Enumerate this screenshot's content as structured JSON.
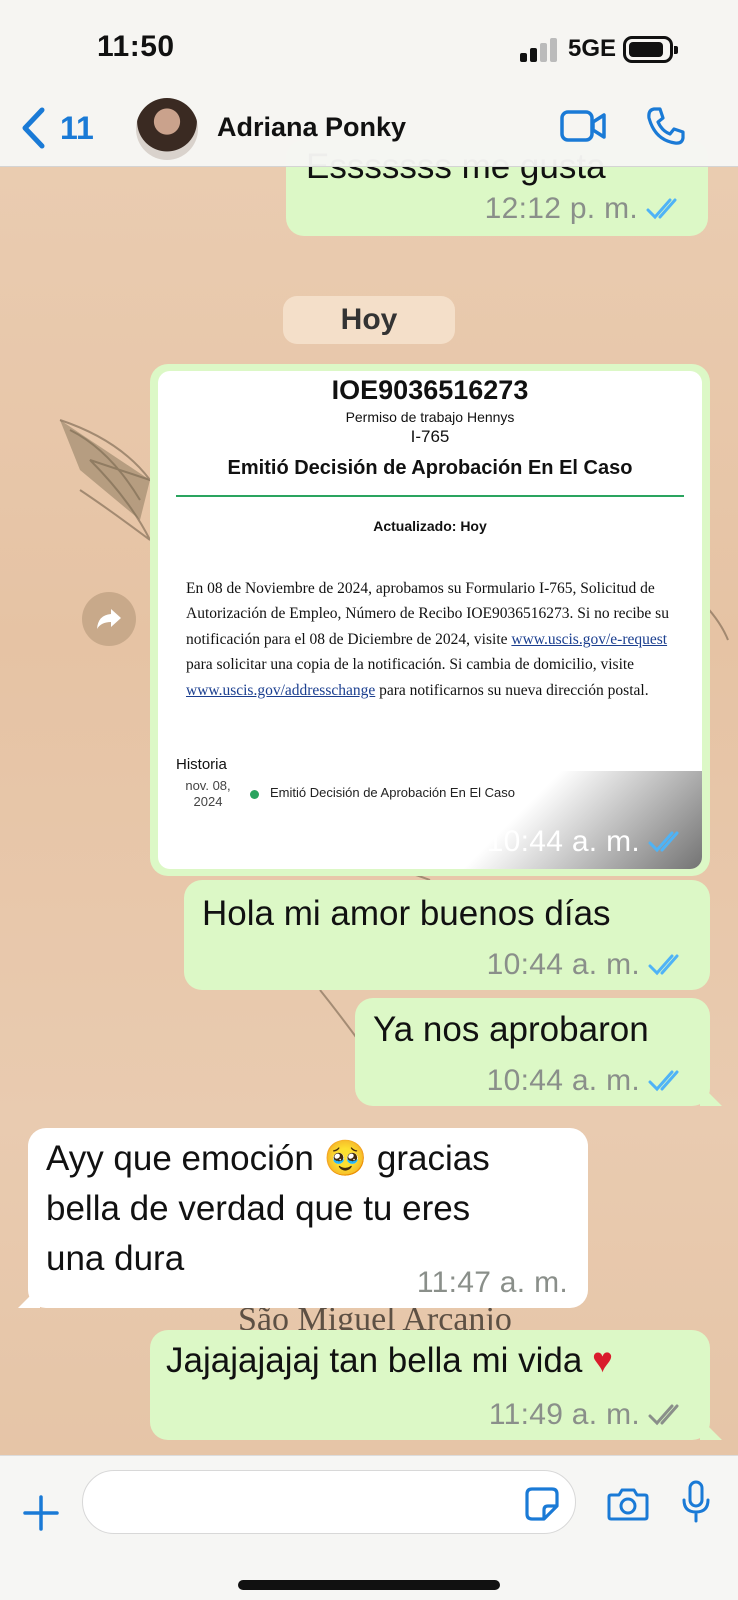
{
  "status_bar": {
    "time": "11:50",
    "network": "5GE"
  },
  "header": {
    "back_count": "11",
    "contact_name": "Adriana Ponky"
  },
  "colors": {
    "accent": "#1a7ad6",
    "outgoing_bubble": "#dcf8c6",
    "incoming_bubble": "#ffffff",
    "read_tick": "#4fb3f6",
    "sent_tick": "#8a8f8a"
  },
  "date_divider": "Hoy",
  "messages": [
    {
      "direction": "outgoing",
      "text": "Esssssss me gusta",
      "time": "12:12 p. m.",
      "status": "read"
    },
    {
      "direction": "outgoing",
      "type": "image",
      "time": "10:44 a. m.",
      "status": "read"
    },
    {
      "direction": "outgoing",
      "text": "Hola mi amor buenos días",
      "time": "10:44 a. m.",
      "status": "read"
    },
    {
      "direction": "outgoing",
      "text": "Ya nos aprobaron",
      "time": "10:44 a. m.",
      "status": "read"
    },
    {
      "direction": "incoming",
      "lines": [
        "Ayy que emoción 🥹 gracias",
        "bella de verdad que tu eres",
        "una dura"
      ],
      "time": "11:47 a. m."
    },
    {
      "direction": "outgoing",
      "text": "Jajajajajaj tan bella mi vida ♥",
      "time": "11:49 a. m.",
      "status": "delivered"
    }
  ],
  "document": {
    "case_id": "IOE9036516273",
    "subtitle": "Permiso de trabajo Hennys",
    "form": "I-765",
    "decision": "Emitió Decisión de Aprobación En El Caso",
    "updated": "Actualizado: Hoy",
    "body_part1": "En 08 de Noviembre de 2024, aprobamos su Formulario I-765, Solicitud de Autorización de Empleo, Número de Recibo IOE9036516273. Si no recibe su notificación para el 08 de Diciembre de 2024, visite ",
    "link1": "www.uscis.gov/e-request",
    "body_part2": " para solicitar una copia de la notificación. Si cambia de domicilio, visite ",
    "link2": "www.uscis.gov/addresschange",
    "body_part3": " para notificarnos su nueva dirección postal.",
    "history_title": "Historia",
    "history_date": "nov. 08, 2024",
    "history_status": "Emitió Decisión de Aprobación En El Caso"
  },
  "wallpaper_text": "São Miguel Arcanjo",
  "icons": [
    "chevron-left-icon",
    "video-call-icon",
    "phone-icon",
    "forward-icon",
    "plus-icon",
    "sticker-icon",
    "camera-icon",
    "microphone-icon"
  ]
}
